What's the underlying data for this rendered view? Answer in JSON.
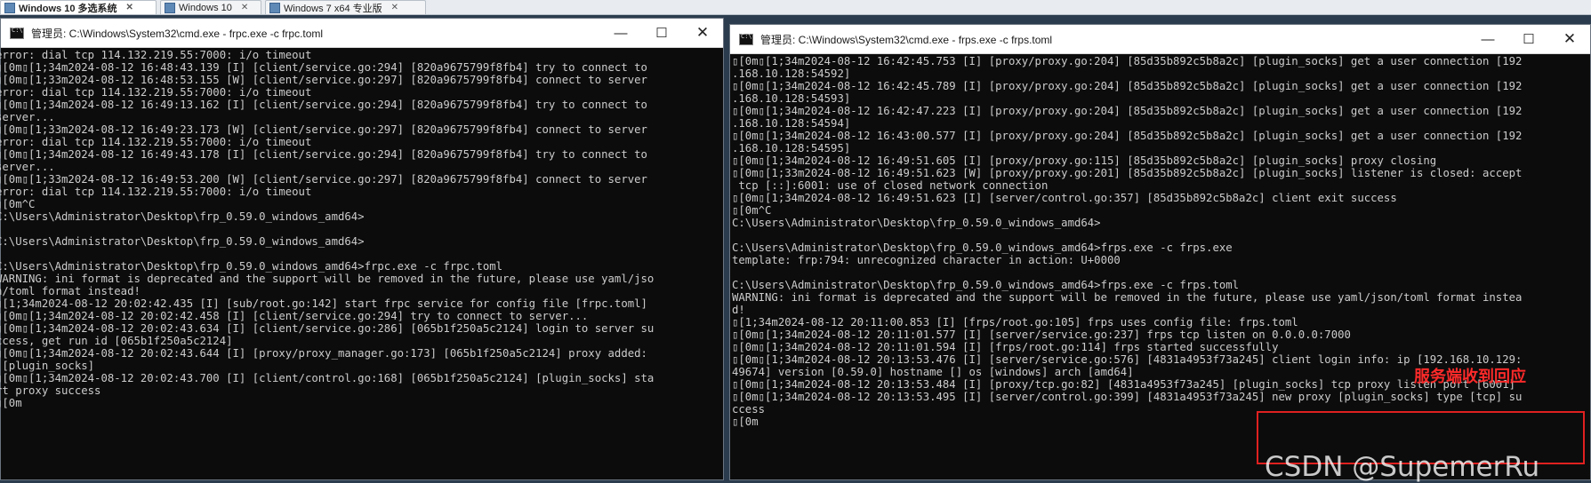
{
  "vm_tabs": [
    {
      "label": "Windows 10 多选系统"
    },
    {
      "label": "Windows 10"
    },
    {
      "label": "Windows 7 x64 专业版"
    }
  ],
  "left_window": {
    "title": "管理员: C:\\Windows\\System32\\cmd.exe - frpc.exe  -c frpc.toml",
    "lines": [
      "error: dial tcp 114.132.219.55:7000: i/o timeout",
      "\u001b[0m\u001b[1;34m2024-08-12 16:48:43.139 [I] [client/service.go:294] [820a9675799f8fb4] try to connect to",
      "\u001b[0m\u001b[1;33m2024-08-12 16:48:53.155 [W] [client/service.go:297] [820a9675799f8fb4] connect to server",
      "error: dial tcp 114.132.219.55:7000: i/o timeout",
      "\u001b[0m\u001b[1;34m2024-08-12 16:49:13.162 [I] [client/service.go:294] [820a9675799f8fb4] try to connect to",
      "server...",
      "\u001b[0m\u001b[1;33m2024-08-12 16:49:23.173 [W] [client/service.go:297] [820a9675799f8fb4] connect to server",
      "error: dial tcp 114.132.219.55:7000: i/o timeout",
      "\u001b[0m\u001b[1;34m2024-08-12 16:49:43.178 [I] [client/service.go:294] [820a9675799f8fb4] try to connect to",
      "server...",
      "\u001b[0m\u001b[1;33m2024-08-12 16:49:53.200 [W] [client/service.go:297] [820a9675799f8fb4] connect to server",
      "error: dial tcp 114.132.219.55:7000: i/o timeout",
      "\u001b[0m^C",
      "C:\\Users\\Administrator\\Desktop\\frp_0.59.0_windows_amd64>",
      "",
      "C:\\Users\\Administrator\\Desktop\\frp_0.59.0_windows_amd64>",
      "",
      "C:\\Users\\Administrator\\Desktop\\frp_0.59.0_windows_amd64>frpc.exe -c frpc.toml",
      "WARNING: ini format is deprecated and the support will be removed in the future, please use yaml/jso",
      "n/toml format instead!",
      "\u001b[1;34m2024-08-12 20:02:42.435 [I] [sub/root.go:142] start frpc service for config file [frpc.toml]",
      "\u001b[0m\u001b[1;34m2024-08-12 20:02:42.458 [I] [client/service.go:294] try to connect to server...",
      "\u001b[0m\u001b[1;34m2024-08-12 20:02:43.634 [I] [client/service.go:286] [065b1f250a5c2124] login to server su",
      "ccess, get run id [065b1f250a5c2124]",
      "\u001b[0m\u001b[1;34m2024-08-12 20:02:43.644 [I] [proxy/proxy_manager.go:173] [065b1f250a5c2124] proxy added:",
      " [plugin_socks]",
      "\u001b[0m\u001b[1;34m2024-08-12 20:02:43.700 [I] [client/control.go:168] [065b1f250a5c2124] [plugin_socks] sta",
      "rt proxy success",
      "\u001b[0m"
    ]
  },
  "right_window": {
    "title": "管理员: C:\\Windows\\System32\\cmd.exe - frps.exe  -c frps.toml",
    "lines": [
      "\u001b[0m\u001b[1;34m2024-08-12 16:42:45.753 [I] [proxy/proxy.go:204] [85d35b892c5b8a2c] [plugin_socks] get a user connection [192",
      ".168.10.128:54592]",
      "\u001b[0m\u001b[1;34m2024-08-12 16:42:45.789 [I] [proxy/proxy.go:204] [85d35b892c5b8a2c] [plugin_socks] get a user connection [192",
      ".168.10.128:54593]",
      "\u001b[0m\u001b[1;34m2024-08-12 16:42:47.223 [I] [proxy/proxy.go:204] [85d35b892c5b8a2c] [plugin_socks] get a user connection [192",
      ".168.10.128:54594]",
      "\u001b[0m\u001b[1;34m2024-08-12 16:43:00.577 [I] [proxy/proxy.go:204] [85d35b892c5b8a2c] [plugin_socks] get a user connection [192",
      ".168.10.128:54595]",
      "\u001b[0m\u001b[1;34m2024-08-12 16:49:51.605 [I] [proxy/proxy.go:115] [85d35b892c5b8a2c] [plugin_socks] proxy closing",
      "\u001b[0m\u001b[1;33m2024-08-12 16:49:51.623 [W] [proxy/proxy.go:201] [85d35b892c5b8a2c] [plugin_socks] listener is closed: accept",
      " tcp [::]:6001: use of closed network connection",
      "\u001b[0m\u001b[1;34m2024-08-12 16:49:51.623 [I] [server/control.go:357] [85d35b892c5b8a2c] client exit success",
      "\u001b[0m^C",
      "C:\\Users\\Administrator\\Desktop\\frp_0.59.0_windows_amd64>",
      "",
      "C:\\Users\\Administrator\\Desktop\\frp_0.59.0_windows_amd64>frps.exe -c frps.exe",
      "template: frp:794: unrecognized character in action: U+0000",
      "",
      "C:\\Users\\Administrator\\Desktop\\frp_0.59.0_windows_amd64>frps.exe -c frps.toml",
      "WARNING: ini format is deprecated and the support will be removed in the future, please use yaml/json/toml format instea",
      "d!",
      "\u001b[1;34m2024-08-12 20:11:00.853 [I] [frps/root.go:105] frps uses config file: frps.toml",
      "\u001b[0m\u001b[1;34m2024-08-12 20:11:01.577 [I] [server/service.go:237] frps tcp listen on 0.0.0.0:7000",
      "\u001b[0m\u001b[1;34m2024-08-12 20:11:01.594 [I] [frps/root.go:114] frps started successfully",
      "\u001b[0m\u001b[1;34m2024-08-12 20:13:53.476 [I] [server/service.go:576] [4831a4953f73a245] client login info: ip [192.168.10.129:",
      "49674] version [0.59.0] hostname [] os [windows] arch [amd64]",
      "\u001b[0m\u001b[1;34m2024-08-12 20:13:53.484 [I] [proxy/tcp.go:82] [4831a4953f73a245] [plugin_socks] tcp proxy listen port [6001]",
      "\u001b[0m\u001b[1;34m2024-08-12 20:13:53.495 [I] [server/control.go:399] [4831a4953f73a245] new proxy [plugin_socks] type [tcp] su",
      "ccess",
      "\u001b[0m"
    ]
  },
  "window_controls": {
    "minimize": "—",
    "maximize": "☐",
    "close": "✕"
  },
  "annotation": "服务端收到回应",
  "watermark": "CSDN @SupemerRu"
}
